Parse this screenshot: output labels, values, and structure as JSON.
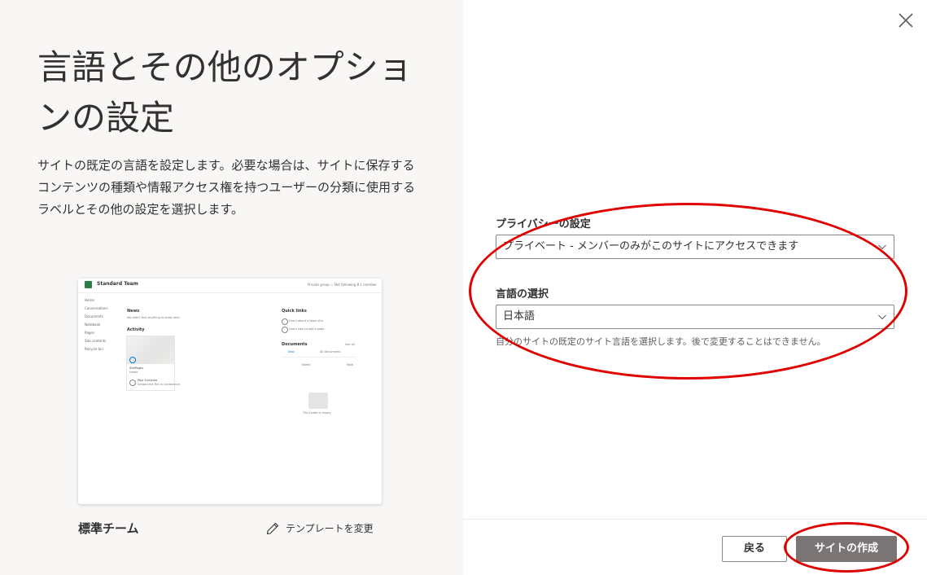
{
  "left_panel": {
    "title": "言語とその他のオプションの設定",
    "description": "サイトの既定の言語を設定します。必要な場合は、サイトに保存するコンテンツの種類や情報アクセス権を持つユーザーの分類に使用するラベルとその他の設定を選択します。",
    "preview": {
      "site_name": "Standard Team",
      "top_links": "Private group  ☆ Not following  8 1 member",
      "nav_items": [
        "Home",
        "Conversations",
        "Documents",
        "Notebook",
        "Pages",
        "Site contents",
        "Recycle bin"
      ],
      "news_heading": "News",
      "news_text": "We didn't find anything to show here.",
      "activity_heading": "Activity",
      "card_title": "SitePages",
      "card_subtitle": "Home",
      "card_user": "Paul Surname",
      "card_user_sub": "Viewed the File in Conference",
      "quick_links_heading": "Quick links",
      "quick_link_1": "Learn about a team site",
      "quick_link_2": "Learn how to add a page",
      "documents_heading": "Documents",
      "see_all": "See all",
      "new_label": "New",
      "all_documents": "All Documents",
      "name_col": "Name",
      "modified_col": "Modi",
      "empty_text": "This folder is empty"
    },
    "template_name": "標準チーム",
    "change_template_label": "テンプレートを変更"
  },
  "form": {
    "privacy_label": "プライバシーの設定",
    "privacy_value": "プライベート - メンバーのみがこのサイトにアクセスできます",
    "language_label": "言語の選択",
    "language_value": "日本語",
    "language_help": "自分のサイトの既定のサイト言語を選択します。後で変更することはできません。"
  },
  "footer": {
    "back_label": "戻る",
    "create_label": "サイトの作成"
  },
  "colors": {
    "left_bg": "#f8f7f6",
    "highlight": "#e00000",
    "create_button": "#7a7574",
    "team_green": "#2e7d46"
  },
  "icons": [
    "close-icon",
    "chevron-down-icon",
    "pencil-icon"
  ]
}
